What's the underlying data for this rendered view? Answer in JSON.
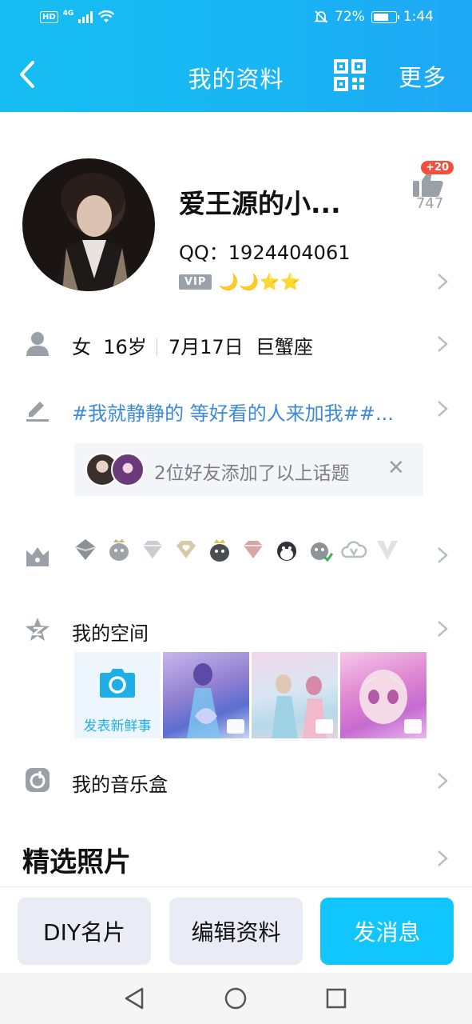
{
  "status_bar": {
    "hd": "HD",
    "network": "4G",
    "battery_percent": "72%",
    "battery_level": 0.72,
    "time": "1:44"
  },
  "title_bar": {
    "back_icon": "chevron-left-icon",
    "title": "我的资料",
    "qr_icon": "qr-code-icon",
    "more": "更多"
  },
  "profile": {
    "nickname": "爱王源的小...",
    "qq_label": "QQ：",
    "qq_number": "1924404061",
    "vip_badge": "VIP",
    "level_icons": "🌙🌙⭐⭐",
    "like_badge": "+20",
    "like_count": "747"
  },
  "info": {
    "gender": "女",
    "age": "16岁",
    "birthday": "7月17日",
    "zodiac": "巨蟹座"
  },
  "signature": {
    "text": "#我就静静的 等好看的人来加我##..."
  },
  "friends_topic": {
    "text": "2位好友添加了以上话题",
    "close": "✕"
  },
  "badges": [
    "silver-crown-badge",
    "penguin-crown-badge",
    "diamond-badge",
    "heart-diamond-badge",
    "black-penguin-badge",
    "pink-diamond-badge",
    "penguin-badge",
    "green-penguin-badge",
    "cloud-v-badge",
    "v-badge"
  ],
  "zone": {
    "label": "我的空间",
    "post_label": "发表新鲜事"
  },
  "music": {
    "label": "我的音乐盒"
  },
  "photos": {
    "title": "精选照片"
  },
  "actions": {
    "diy": "DIY名片",
    "edit": "编辑资料",
    "message": "发消息"
  },
  "colors": {
    "header_start": "#16bdf2",
    "header_end": "#1fa7f5",
    "primary_button": "#11c5ff",
    "signature_link": "#3d8ad9",
    "badge_red": "#f44f3b"
  }
}
